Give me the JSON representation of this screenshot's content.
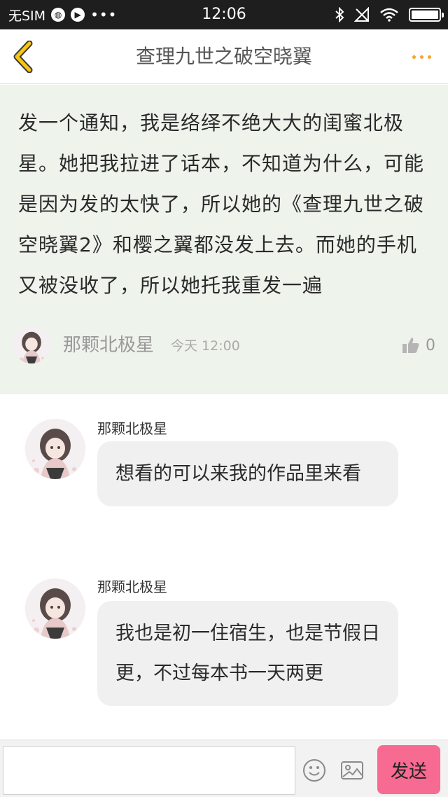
{
  "status_bar": {
    "carrier": "无SIM",
    "time": "12:06",
    "icons": [
      "globe-icon",
      "play-icon",
      "more-dots-icon",
      "bluetooth-icon",
      "no-signal-icon",
      "wifi-icon",
      "battery-icon"
    ],
    "battery_level": 1.0
  },
  "nav": {
    "title": "查理九世之破空晓翼",
    "back_icon": "chevron-left-icon",
    "more_icon": "more-horizontal-icon",
    "accent_color": "#f5c518"
  },
  "post": {
    "text": "发一个通知，我是络绎不绝大大的闺蜜北极星。她把我拉进了话本，不知道为什么，可能是因为发的太快了，所以她的《查理九世之破空晓翼2》和樱之翼都没发上去。而她的手机又被没收了，所以她托我重发一遍",
    "author": "那颗北极星",
    "time": "今天 12:00",
    "likes": "0",
    "like_icon": "thumbs-up-icon",
    "background_color": "#eef3ec"
  },
  "comments": [
    {
      "author": "那颗北极星",
      "text": "想看的可以来我的作品里来看"
    },
    {
      "author": "那颗北极星",
      "text": "我也是初一住宿生，也是节假日更，不过每本书一天两更"
    }
  ],
  "input_bar": {
    "input_value": "",
    "emoji_icon": "smiley-icon",
    "image_icon": "image-icon",
    "send_label": "发送",
    "send_color": "#f76a92"
  }
}
